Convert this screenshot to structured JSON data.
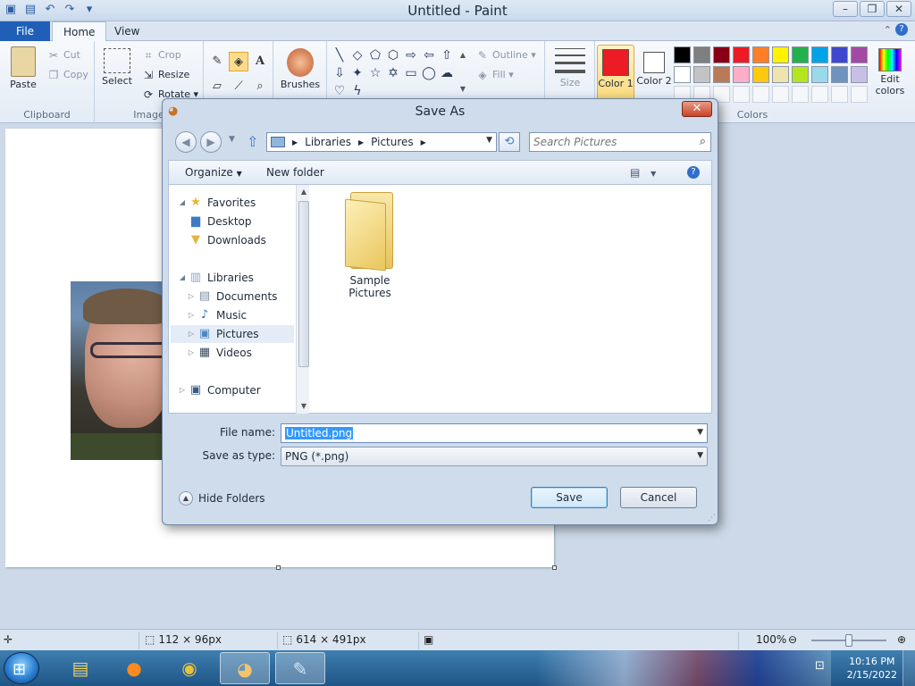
{
  "paint": {
    "title": "Untitled - Paint",
    "tabs": {
      "file": "File",
      "home": "Home",
      "view": "View"
    },
    "clipboard": {
      "paste": "Paste",
      "cut": "Cut",
      "copy": "Copy",
      "group": "Clipboard"
    },
    "image": {
      "select": "Select",
      "crop": "Crop",
      "resize": "Resize",
      "rotate": "Rotate",
      "group": "Image"
    },
    "tools": {
      "brushes": "Brushes"
    },
    "shapes": {
      "outline": "Outline",
      "fill": "Fill"
    },
    "size_label": "Size",
    "color1_label": "Color 1",
    "color2_label": "Color 2",
    "edit_colors": "Edit colors",
    "colors_group": "Colors",
    "palette_row1": [
      "#000000",
      "#7f7f7f",
      "#880015",
      "#ed1c24",
      "#ff7f27",
      "#fff200",
      "#22b14c",
      "#00a2e8",
      "#3f48cc",
      "#a349a4"
    ],
    "palette_row2": [
      "#ffffff",
      "#c3c3c3",
      "#b97a57",
      "#ffaec9",
      "#ffc90e",
      "#efe4b0",
      "#b5e61d",
      "#99d9ea",
      "#7092be",
      "#c8bfe7"
    ],
    "color1": "#ed1c24",
    "color2": "#ffffff"
  },
  "status": {
    "selection_size": "112 × 96px",
    "canvas_size": "614 × 491px",
    "zoom": "100%"
  },
  "taskbar": {
    "time": "10:16 PM",
    "date": "2/15/2022"
  },
  "dialog": {
    "title": "Save As",
    "breadcrumb": [
      "Libraries",
      "Pictures"
    ],
    "search_placeholder": "Search Pictures",
    "organize": "Organize",
    "new_folder": "New folder",
    "nav": {
      "favorites": "Favorites",
      "desktop": "Desktop",
      "downloads": "Downloads",
      "libraries": "Libraries",
      "documents": "Documents",
      "music": "Music",
      "pictures": "Pictures",
      "videos": "Videos",
      "computer": "Computer"
    },
    "folder_name": "Sample Pictures",
    "file_name_label": "File name:",
    "file_name": "Untitled.png",
    "save_type_label": "Save as type:",
    "save_type": "PNG (*.png)",
    "hide_folders": "Hide Folders",
    "save": "Save",
    "cancel": "Cancel"
  }
}
